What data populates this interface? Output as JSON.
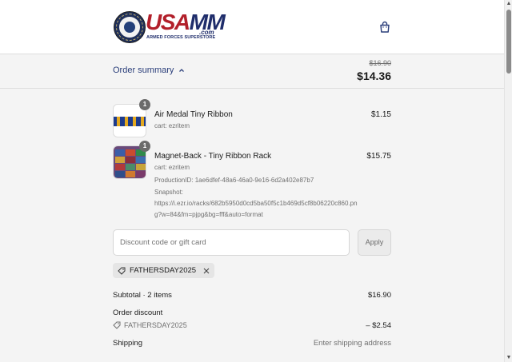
{
  "header": {
    "logo_text_usa": "USA",
    "logo_text_mm": "MM",
    "logo_com": ".com",
    "logo_tagline": "ARMED FORCES SUPERSTORE"
  },
  "summary": {
    "toggle_label": "Order summary",
    "original_price": "$16.90",
    "total_price": "$14.36"
  },
  "items": [
    {
      "quantity": "1",
      "name": "Air Medal Tiny Ribbon",
      "cart": "cart: ezritem",
      "price": "$1.15"
    },
    {
      "quantity": "1",
      "name": "Magnet-Back - Tiny Ribbon Rack",
      "cart": "cart: ezritem",
      "price": "$15.75",
      "production_id": "ProductionID: 1ae6dfef-48a6-46a0-9e16-6d2a402e87b7",
      "snapshot_label": "Snapshot:",
      "snapshot_url_1": "https://i.ezr.io/racks/682b5950d0cd5ba50f5c1b469d5cf8b06220c860.pn",
      "snapshot_url_2": "g?w=84&fm=pjpg&bg=fff&auto=format"
    }
  ],
  "discount": {
    "placeholder": "Discount code or gift card",
    "apply_label": "Apply",
    "applied_code": "FATHERSDAY2025"
  },
  "totals": {
    "subtotal_label": "Subtotal · 2 items",
    "subtotal_value": "$16.90",
    "order_discount_label": "Order discount",
    "discount_code": "FATHERSDAY2025",
    "discount_value": "– $2.54",
    "shipping_label": "Shipping",
    "shipping_value": "Enter shipping address"
  },
  "colors": {
    "accent_blue": "#2a3e7a",
    "brand_red": "#b21f2a",
    "brand_navy": "#1f2d6b"
  }
}
